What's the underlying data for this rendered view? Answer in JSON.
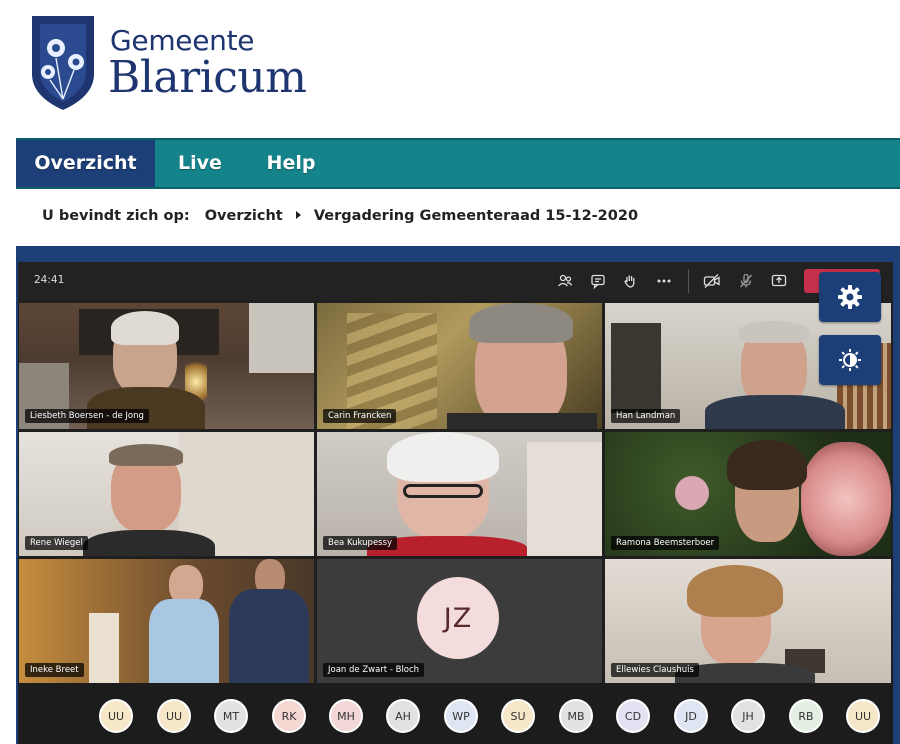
{
  "brand": {
    "line1": "Gemeente",
    "line2": "Blaricum"
  },
  "nav": [
    {
      "label": "Overzicht",
      "active": true
    },
    {
      "label": "Live",
      "active": false
    },
    {
      "label": "Help",
      "active": false
    }
  ],
  "breadcrumb": {
    "lead": "U bevindt zich op:",
    "items": [
      "Overzicht",
      "Vergadering Gemeenteraad 15-12-2020"
    ]
  },
  "meeting": {
    "time": "24:41",
    "toolbar_icons": [
      "participants-icon",
      "chat-icon",
      "raise-hand-icon",
      "more-icon",
      "camera-off-icon",
      "mic-off-icon",
      "share-screen-icon"
    ],
    "leave_color": "#c4314b"
  },
  "participants": [
    {
      "name": "Liesbeth Boersen - de Jong"
    },
    {
      "name": "Carin Francken"
    },
    {
      "name": "Han Landman"
    },
    {
      "name": "Rene Wiegel"
    },
    {
      "name": "Bea Kukupessy"
    },
    {
      "name": "Ramona Beemsterboer"
    },
    {
      "name": "Ineke Breet"
    },
    {
      "name": "Joan de Zwart - Bloch",
      "initials": "JZ"
    },
    {
      "name": "Ellewies Claushuis"
    }
  ],
  "roster": [
    {
      "initials": "UU",
      "color": "#f6e7c8"
    },
    {
      "initials": "UU",
      "color": "#f6e7c8"
    },
    {
      "initials": "MT",
      "color": "#e2e2e2"
    },
    {
      "initials": "RK",
      "color": "#f6d8d3"
    },
    {
      "initials": "MH",
      "color": "#f3d6d6"
    },
    {
      "initials": "AH",
      "color": "#e2e2e2"
    },
    {
      "initials": "WP",
      "color": "#dfe6f3"
    },
    {
      "initials": "SU",
      "color": "#f6e7c8"
    },
    {
      "initials": "MB",
      "color": "#e2e2e2"
    },
    {
      "initials": "CD",
      "color": "#e2e2f3"
    },
    {
      "initials": "JD",
      "color": "#dfe6f3"
    },
    {
      "initials": "JH",
      "color": "#e2e2e2"
    },
    {
      "initials": "RB",
      "color": "#e3efe3"
    },
    {
      "initials": "UU",
      "color": "#f6e7c8"
    }
  ],
  "side_buttons": [
    "settings-gear-icon",
    "contrast-toggle-icon"
  ],
  "colors": {
    "teal_nav": "#14838a",
    "navy": "#1d3f78",
    "brand_text": "#1f3570"
  }
}
